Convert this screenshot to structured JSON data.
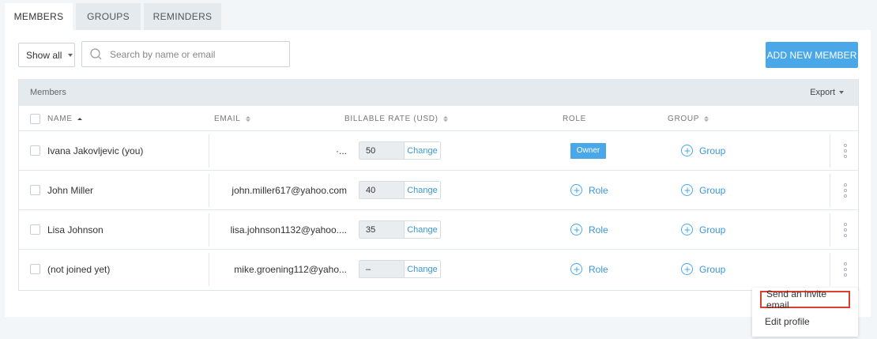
{
  "tabs": [
    {
      "label": "MEMBERS",
      "active": true
    },
    {
      "label": "GROUPS",
      "active": false
    },
    {
      "label": "REMINDERS",
      "active": false
    }
  ],
  "toolbar": {
    "filter_value": "Show all",
    "search_placeholder": "Search by name or email",
    "add_button_label": "ADD NEW MEMBER"
  },
  "table": {
    "section_label": "Members",
    "export_label": "Export",
    "columns": {
      "name": "NAME",
      "email": "EMAIL",
      "rate": "BILLABLE RATE (USD)",
      "role": "ROLE",
      "group": "GROUP"
    },
    "rows": [
      {
        "name": "Ivana Jakovljevic (you)",
        "email": "·...",
        "rate": "50",
        "change": "Change",
        "role": "Owner",
        "role_type": "badge",
        "group": "Group"
      },
      {
        "name": "John Miller",
        "email": "john.miller617@yahoo.com",
        "rate": "40",
        "change": "Change",
        "role": "Role",
        "role_type": "link",
        "group": "Group"
      },
      {
        "name": "Lisa Johnson",
        "email": "lisa.johnson1132@yahoo....",
        "rate": "35",
        "change": "Change",
        "role": "Role",
        "role_type": "link",
        "group": "Group"
      },
      {
        "name": "(not joined yet)",
        "email": "mike.groening112@yaho...",
        "rate": "–",
        "change": "Change",
        "role": "Role",
        "role_type": "link",
        "group": "Group"
      }
    ]
  },
  "menu": {
    "send_invite": "Send an invite email",
    "edit_profile": "Edit profile"
  },
  "colors": {
    "accent": "#4aa8e8",
    "highlight_border": "#d9412e"
  }
}
